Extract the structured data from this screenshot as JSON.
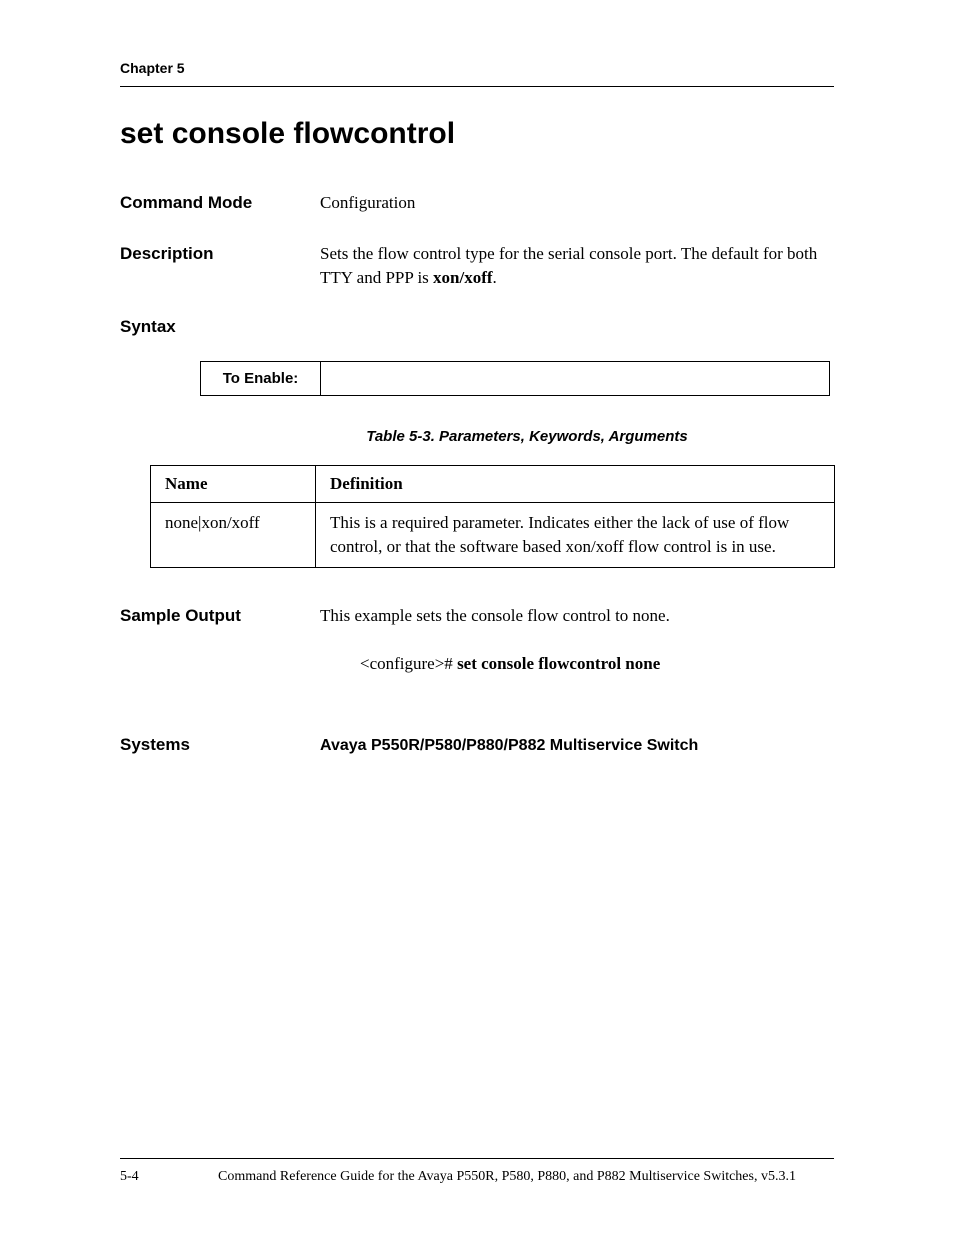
{
  "chapter": "Chapter 5",
  "title": "set console flowcontrol",
  "commandMode": {
    "label": "Command Mode",
    "value": "Configuration"
  },
  "description": {
    "label": "Description",
    "text_part1": "Sets the flow control type for the serial console port. The default for both TTY and PPP is ",
    "text_bold": "xon/xoff",
    "text_part2": "."
  },
  "syntax": {
    "label": "Syntax",
    "enable_label": "To Enable:",
    "enable_value": ""
  },
  "tableCaption": "Table 5-3.  Parameters, Keywords, Arguments",
  "paramsTable": {
    "headers": {
      "name": "Name",
      "definition": "Definition"
    },
    "rows": [
      {
        "name": "none|xon/xoff",
        "definition": "This is a required parameter. Indicates either the lack of use of flow control, or that the software based xon/xoff flow control is in use."
      }
    ]
  },
  "sampleOutput": {
    "label": "Sample Output",
    "text": "This example sets the console flow control to none.",
    "command_prefix": "<configure># ",
    "command_bold": "set console flowcontrol none"
  },
  "systems": {
    "label": "Systems",
    "value": "Avaya P550R/P580/P880/P882 Multiservice Switch"
  },
  "footer": {
    "page": "5-4",
    "text": "Command Reference Guide for the Avaya P550R, P580, P880, and P882 Multiservice Switches, v5.3.1"
  }
}
